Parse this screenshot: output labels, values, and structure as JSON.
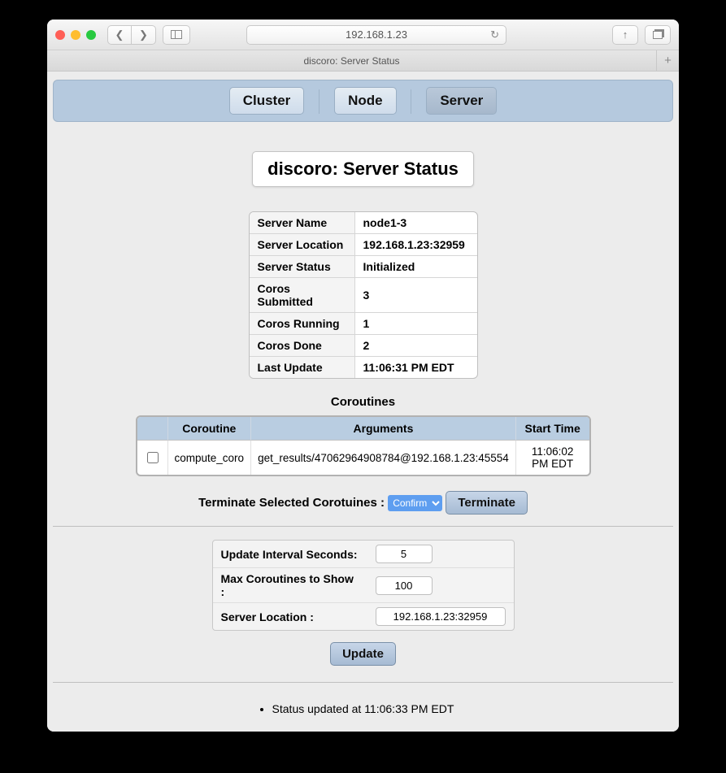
{
  "browser": {
    "address": "192.168.1.23",
    "tab_title": "discoro: Server Status"
  },
  "nav": {
    "links": [
      "Cluster",
      "Node",
      "Server"
    ],
    "active": 2
  },
  "page_title": "discoro: Server Status",
  "status_rows": [
    {
      "k": "Server Name",
      "v": "node1-3"
    },
    {
      "k": "Server Location",
      "v": "192.168.1.23:32959"
    },
    {
      "k": "Server Status",
      "v": "Initialized"
    },
    {
      "k": "Coros Submitted",
      "v": "3"
    },
    {
      "k": "Coros Running",
      "v": "1"
    },
    {
      "k": "Coros Done",
      "v": "2"
    },
    {
      "k": "Last Update",
      "v": "11:06:31 PM EDT"
    }
  ],
  "coroutines": {
    "header": "Coroutines",
    "columns": [
      "",
      "Coroutine",
      "Arguments",
      "Start Time"
    ],
    "rows": [
      {
        "coro": "compute_coro",
        "args": "get_results/47062964908784@192.168.1.23:45554",
        "start": "11:06:02 PM EDT"
      }
    ]
  },
  "terminate": {
    "label": "Terminate Selected Corotuines :",
    "select_value": "Confirm",
    "button": "Terminate"
  },
  "settings": {
    "rows": [
      {
        "k": "Update Interval Seconds:",
        "v": "5",
        "wide": false
      },
      {
        "k": "Max Coroutines to Show :",
        "v": "100",
        "wide": false
      },
      {
        "k": "Server Location :",
        "v": "192.168.1.23:32959",
        "wide": true
      }
    ],
    "button": "Update"
  },
  "status_message": "Status updated at 11:06:33 PM EDT"
}
